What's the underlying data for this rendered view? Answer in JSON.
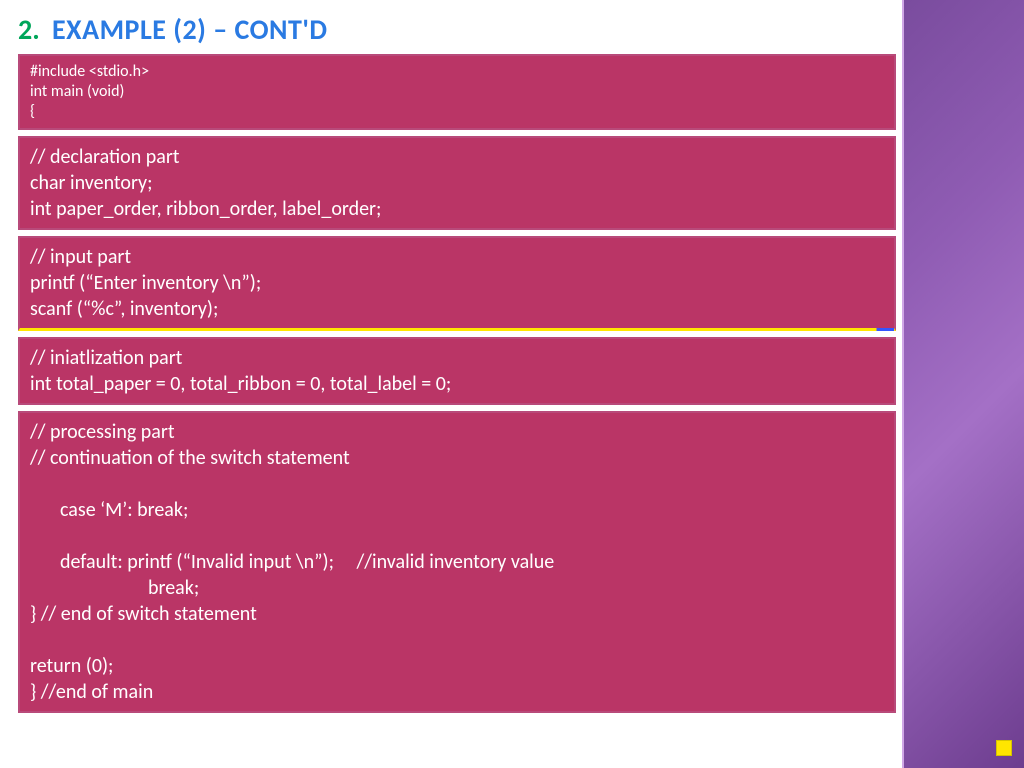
{
  "title": {
    "number": "2.",
    "text": "EXAMPLE (2) – CONT'D"
  },
  "blocks": {
    "header": {
      "l1": "#include <stdio.h>",
      "l2": "int main (void)",
      "l3": "{"
    },
    "decl": {
      "l1": "// declaration part",
      "l2": "char inventory;",
      "l3": "int paper_order, ribbon_order, label_order;"
    },
    "input": {
      "l1": "// input part",
      "l2": "printf (“Enter inventory \\n”);",
      "l3": "scanf (“%c”, inventory);"
    },
    "init": {
      "l1": "// iniatlization part",
      "l2": "int total_paper = 0, total_ribbon = 0, total_label = 0;"
    },
    "proc": {
      "l1": "// processing part",
      "l2": "// continuation of the switch statement",
      "l3": "case ‘M’: break;",
      "l4": "default: printf (“Invalid input \\n”);     //invalid inventory value",
      "l5": "break;",
      "l6": "} // end of switch statement",
      "l7": "return (0);",
      "l8": "} //end of main"
    }
  }
}
